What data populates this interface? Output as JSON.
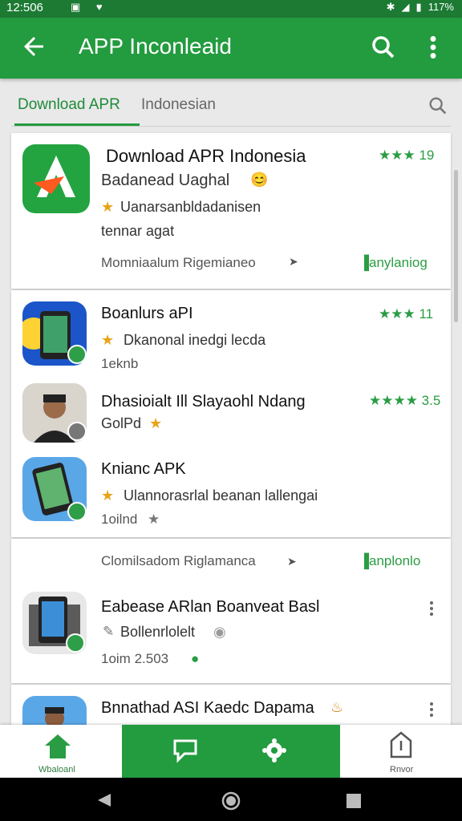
{
  "status_bar": {
    "time": "12:506",
    "battery": "117%"
  },
  "app_bar": {
    "title": "APP Inconleaid"
  },
  "search": {
    "active_tab": "Download APR",
    "query": "Indonesian"
  },
  "items": [
    {
      "title": "Download APR Indonesia",
      "subtitle": "Badanead Uaghal",
      "desc1": "Uanarsanbldadanisen",
      "desc2": "tennar agat",
      "rating": "★★★ 19",
      "footer_left": "Momniaalum Rigemianeo",
      "footer_right": "anylaniog"
    },
    {
      "title": "Boanlurs aPI",
      "desc1": "Dkanonal inedgi lecda",
      "desc2": "1eknb",
      "rating": "★★★ 11"
    },
    {
      "title": "Dhasioialt Ill Slayaohl Ndang",
      "desc1": "GolPd",
      "rating": "★★★★ 3.5"
    },
    {
      "title": "Knianc APK",
      "desc1": "Ulannorasrlal beanan lallengai",
      "desc2": "1oilnd"
    },
    {
      "title": "Eabease ARlan Boanveat Basl",
      "desc1": "Bollenrlolelt",
      "desc2": "1oim 2.503"
    },
    {
      "title": "Bnnathad ASI Kaedc Dapama"
    }
  ],
  "section2": {
    "left": "Clomilsadom Riglamanca",
    "right": "anplonlo"
  },
  "bottom_nav": {
    "left_label": "Wbaloanl",
    "right_label": "Rnvor"
  },
  "colors": {
    "primary": "#239b3f",
    "status": "#1c7a33",
    "rating": "#2a9d44"
  }
}
